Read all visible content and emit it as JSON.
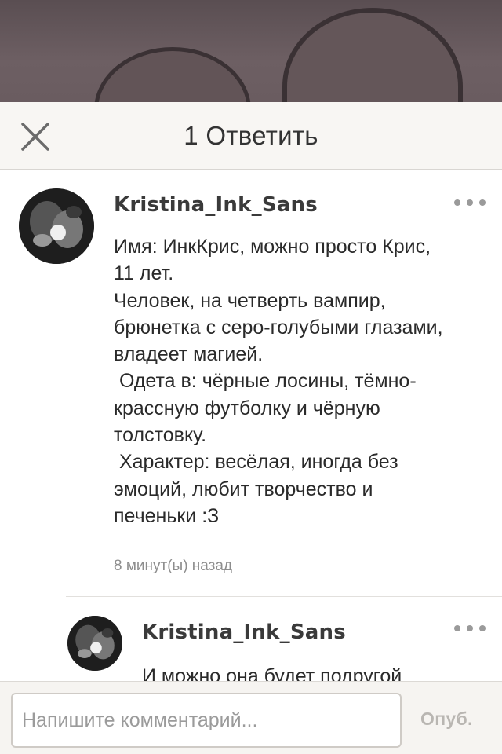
{
  "sheet": {
    "title": "1 Ответить",
    "close_icon": "close-x-icon"
  },
  "comments": [
    {
      "username": "Kristina_Ink_Sans",
      "body": "Имя: ИнкКрис, можно просто Крис,\n11 лет.\nЧеловек, на четверть вампир,\nбрюнетка с серо-голубыми глазами,\nвладеет магией.\n Одета в: чёрные лосины, тёмно-\nкрассную футболку и чёрную\nтолстовку.\n Характер: весёлая, иногда без\nэмоций, любит творчество и\nпеченьки :З",
      "timestamp": "8 минут(ы) назад",
      "more_icon": "more-dots-icon"
    },
    {
      "username": "Kristina_Ink_Sans",
      "body": "И можно она будет подругой",
      "more_icon": "more-dots-icon"
    }
  ],
  "composer": {
    "placeholder": "Напишите комментарий...",
    "value": "",
    "publish_label": "Опуб."
  },
  "colors": {
    "header_bg": "#f8f6f3",
    "text": "#2a2a2a",
    "muted": "#8d8d8d",
    "publish_disabled": "#b9b6b2"
  }
}
